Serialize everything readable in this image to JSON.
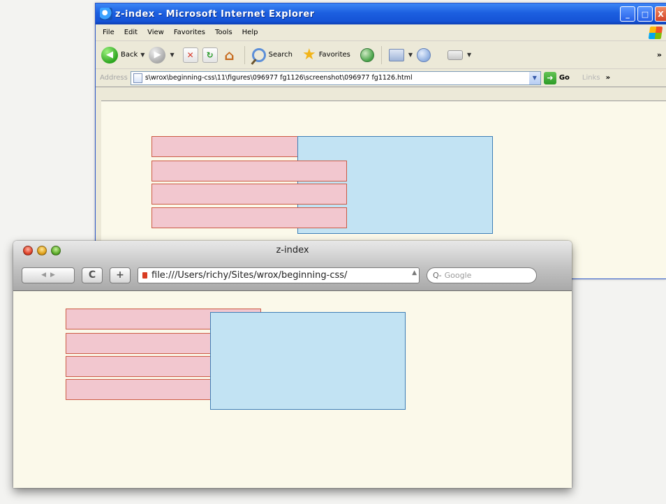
{
  "ie_window": {
    "title": "z-index - Microsoft Internet Explorer",
    "menu": [
      "File",
      "Edit",
      "View",
      "Favorites",
      "Tools",
      "Help"
    ],
    "toolbar": {
      "back_label": "Back",
      "search_label": "Search",
      "favorites_label": "Favorites",
      "more_glyph": "»"
    },
    "address": {
      "label": "Address",
      "value": "s\\wrox\\beginning-css\\11\\figures\\096977 fg1126\\screenshot\\096977 fg1126.html",
      "go_label": "Go",
      "links_label": "Links",
      "more_glyph": "»"
    },
    "window_buttons": {
      "minimize": "_",
      "maximize": "□",
      "close": "X"
    }
  },
  "safari_window": {
    "title": "z-index",
    "url": "file:///Users/richy/Sites/wrox/beginning-css/",
    "search_placeholder": "Google",
    "buttons": {
      "reload": "C",
      "add_bookmark": "+",
      "back": "◀",
      "forward": "▶"
    }
  },
  "demo": {
    "pink_color": "#f2c7cf",
    "pink_border": "#cc5a44",
    "blue_color": "#c2e3f3",
    "blue_border": "#3e7fb7"
  },
  "icons": [
    "ie-logo-icon",
    "windows-flag-icon",
    "back-arrow-icon",
    "forward-arrow-icon",
    "stop-icon",
    "refresh-icon",
    "home-icon",
    "search-icon",
    "favorites-star-icon",
    "media-icon",
    "history-icon",
    "mail-icon",
    "print-icon",
    "page-icon",
    "go-arrow-icon",
    "favicon-icon",
    "magnifier-icon"
  ]
}
